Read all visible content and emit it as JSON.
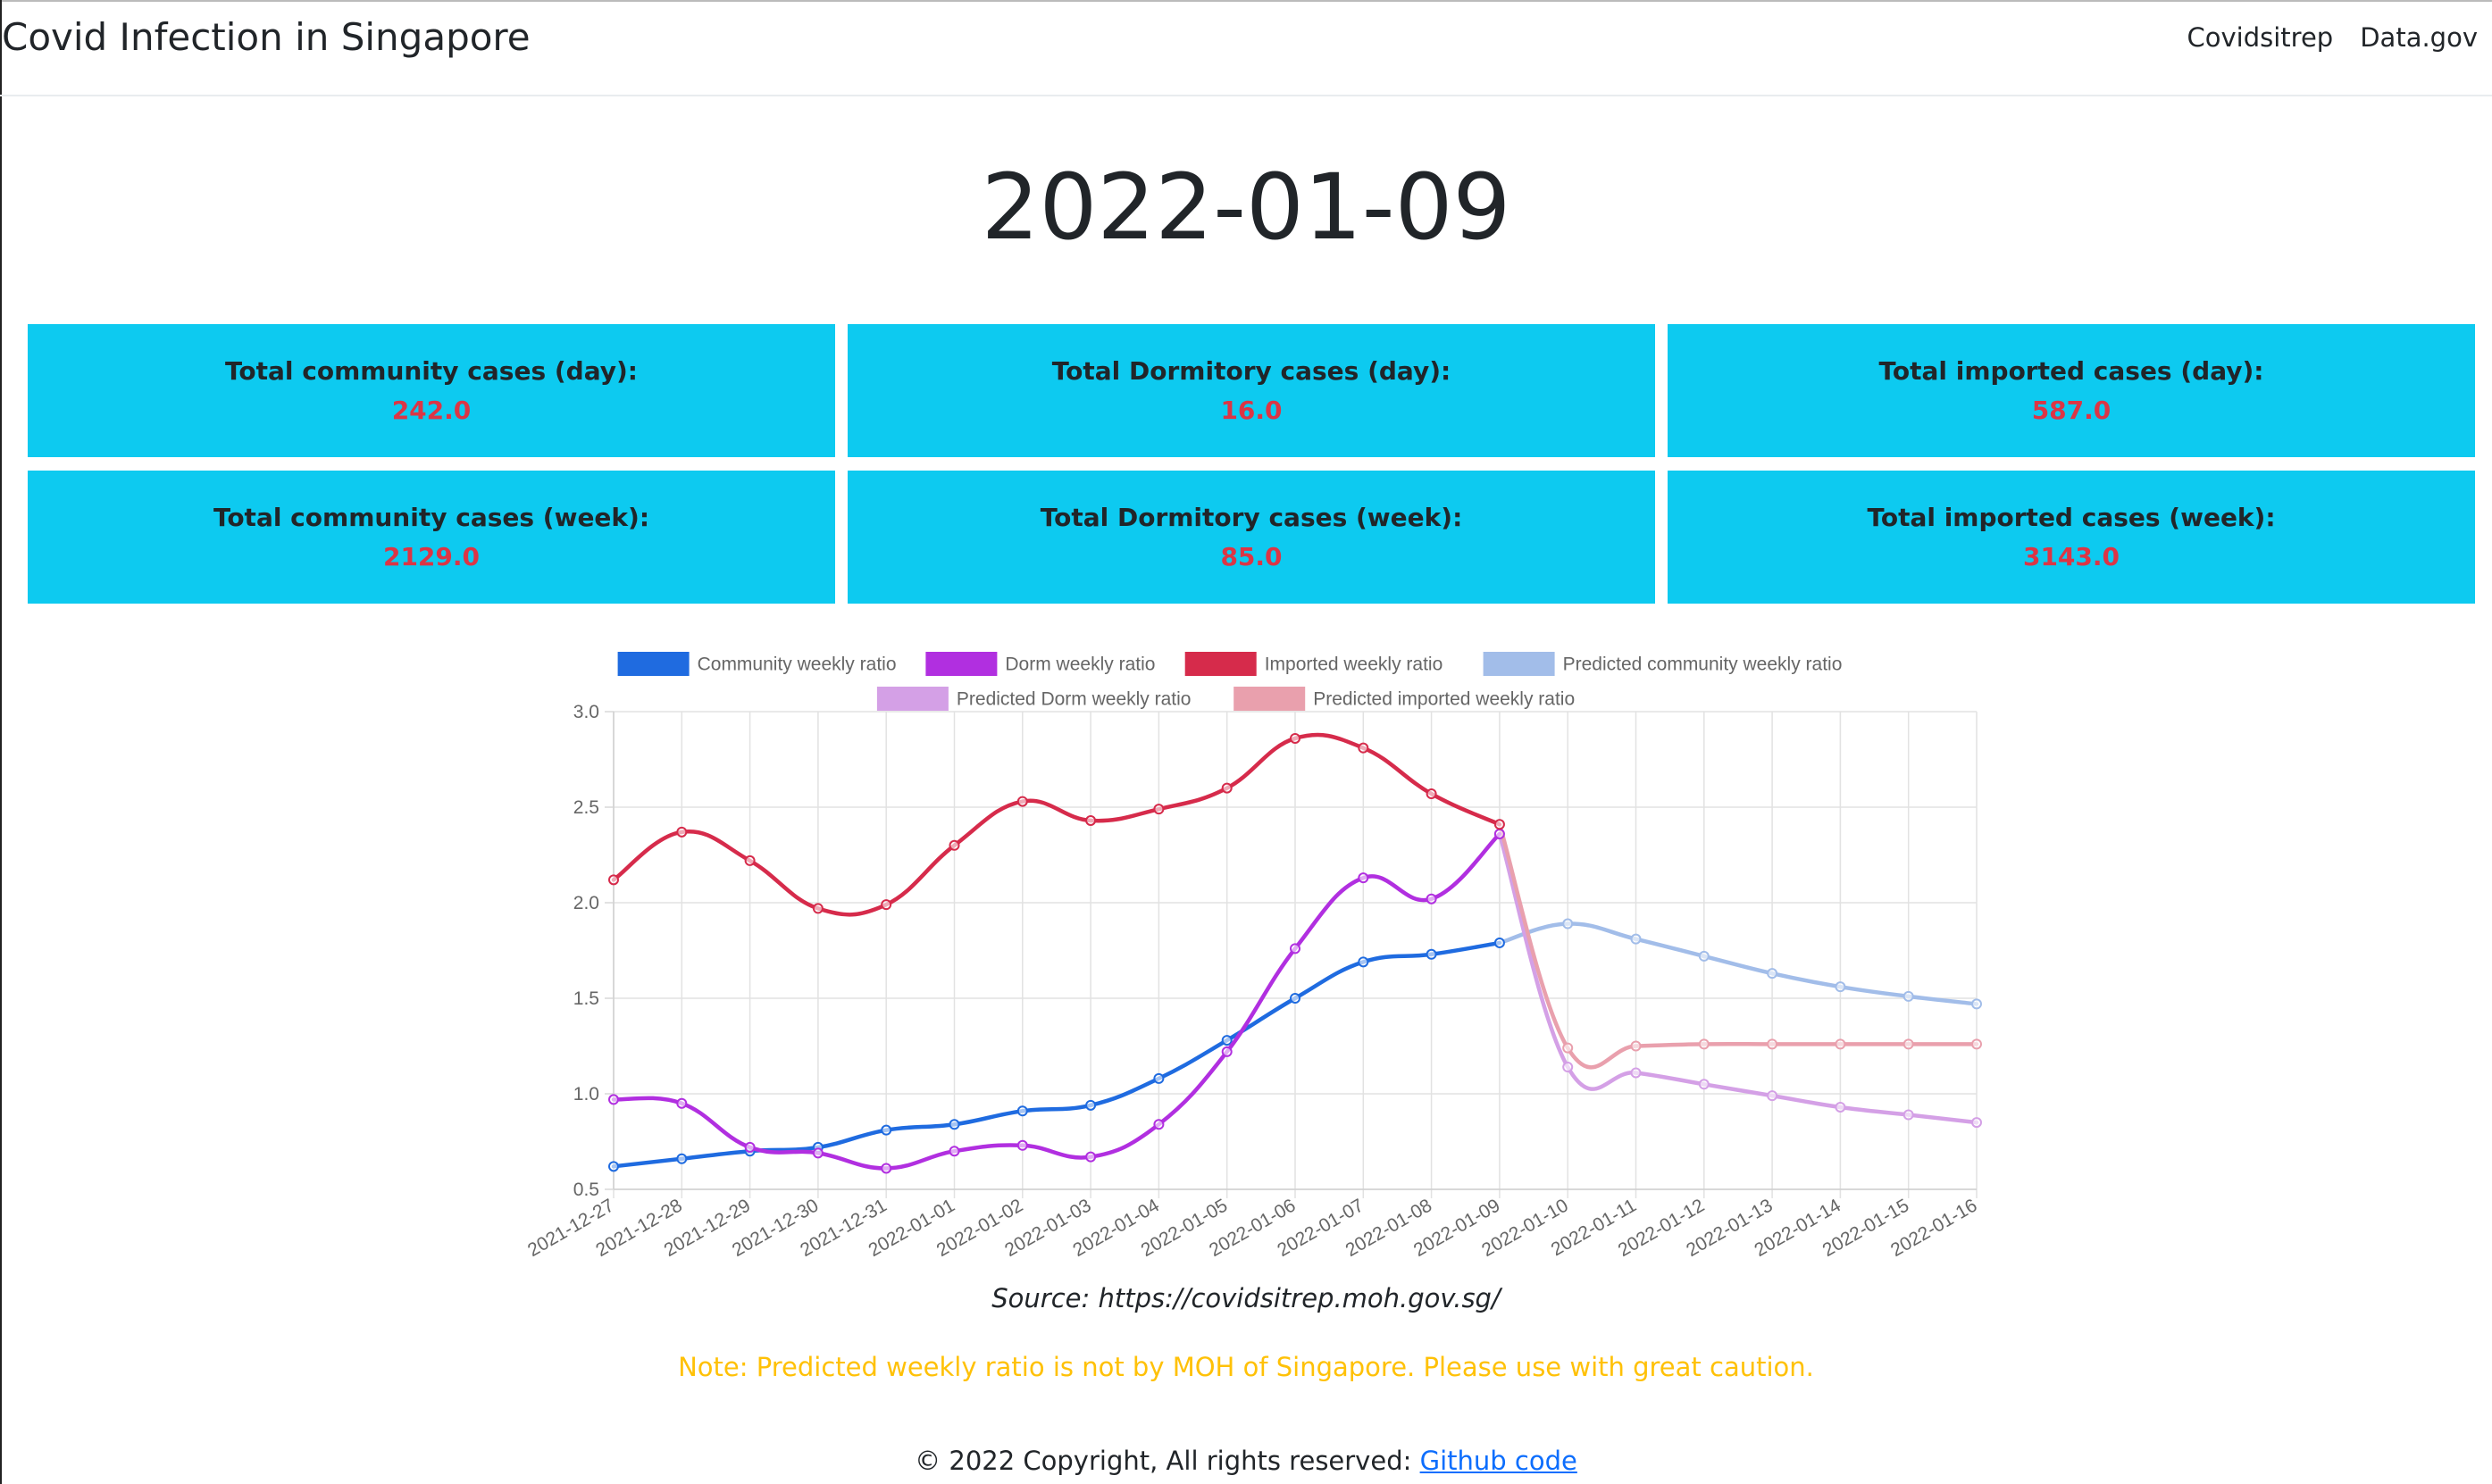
{
  "app": {
    "brand": "Covid Infection in Singapore",
    "nav": [
      "Covidsitrep",
      "Data.gov"
    ]
  },
  "date": "2022-01-09",
  "cards": [
    {
      "label": "Total community cases (day):",
      "value": "242.0"
    },
    {
      "label": "Total Dormitory cases (day):",
      "value": "16.0"
    },
    {
      "label": "Total imported cases (day):",
      "value": "587.0"
    },
    {
      "label": "Total community cases (week):",
      "value": "2129.0"
    },
    {
      "label": "Total Dormitory cases (week):",
      "value": "85.0"
    },
    {
      "label": "Total imported cases (week):",
      "value": "3143.0"
    }
  ],
  "source": "Source: https://covidsitrep.moh.gov.sg/",
  "note": "Note: Predicted weekly ratio is not by MOH of Singapore. Please use with great caution.",
  "footer": {
    "text": "© 2022 Copyright, All rights reserved: ",
    "link": "Github code"
  },
  "colors": {
    "card_bg": "#0dcaf0",
    "card_value": "#dc3545",
    "note": "#ffc107",
    "link": "#0d6efd"
  },
  "chart_data": {
    "type": "line",
    "title": "",
    "xlabel": "",
    "ylabel": "",
    "ylim": [
      0.5,
      3.0
    ],
    "yticks": [
      "0.5",
      "1.0",
      "1.5",
      "2.0",
      "2.5",
      "3.0"
    ],
    "grid": true,
    "legend_position": "top",
    "x": [
      "2021-12-27",
      "2021-12-28",
      "2021-12-29",
      "2021-12-30",
      "2021-12-31",
      "2022-01-01",
      "2022-01-02",
      "2022-01-03",
      "2022-01-04",
      "2022-01-05",
      "2022-01-06",
      "2022-01-07",
      "2022-01-08",
      "2022-01-09",
      "2022-01-10",
      "2022-01-11",
      "2022-01-12",
      "2022-01-13",
      "2022-01-14",
      "2022-01-15",
      "2022-01-16"
    ],
    "series": [
      {
        "name": "Community weekly ratio",
        "color": "#1f6be0",
        "values": [
          0.62,
          0.66,
          0.7,
          0.72,
          0.81,
          0.84,
          0.91,
          0.94,
          1.08,
          1.28,
          1.5,
          1.69,
          1.73,
          1.79,
          null,
          null,
          null,
          null,
          null,
          null,
          null
        ]
      },
      {
        "name": "Dorm weekly ratio",
        "color": "#b12fe0",
        "values": [
          0.97,
          0.95,
          0.72,
          0.69,
          0.61,
          0.7,
          0.73,
          0.67,
          0.84,
          1.22,
          1.76,
          2.13,
          2.02,
          2.36,
          null,
          null,
          null,
          null,
          null,
          null,
          null
        ]
      },
      {
        "name": "Imported weekly ratio",
        "color": "#d62b4b",
        "values": [
          2.12,
          2.37,
          2.22,
          1.97,
          1.99,
          2.3,
          2.53,
          2.43,
          2.49,
          2.6,
          2.86,
          2.81,
          2.57,
          2.41,
          null,
          null,
          null,
          null,
          null,
          null,
          null
        ]
      },
      {
        "name": "Predicted community weekly ratio",
        "color": "#a2bde9",
        "values": [
          null,
          null,
          null,
          null,
          null,
          null,
          null,
          null,
          null,
          null,
          null,
          null,
          null,
          1.79,
          1.89,
          1.81,
          1.72,
          1.63,
          1.56,
          1.51,
          1.47
        ]
      },
      {
        "name": "Predicted Dorm weekly ratio",
        "color": "#d4a0e6",
        "values": [
          null,
          null,
          null,
          null,
          null,
          null,
          null,
          null,
          null,
          null,
          null,
          null,
          null,
          2.36,
          1.14,
          1.11,
          1.05,
          0.99,
          0.93,
          0.89,
          0.85
        ]
      },
      {
        "name": "Predicted imported weekly ratio",
        "color": "#e9a0ad",
        "values": [
          null,
          null,
          null,
          null,
          null,
          null,
          null,
          null,
          null,
          null,
          null,
          null,
          null,
          2.41,
          1.24,
          1.25,
          1.26,
          1.26,
          1.26,
          1.26,
          1.26
        ]
      }
    ]
  }
}
